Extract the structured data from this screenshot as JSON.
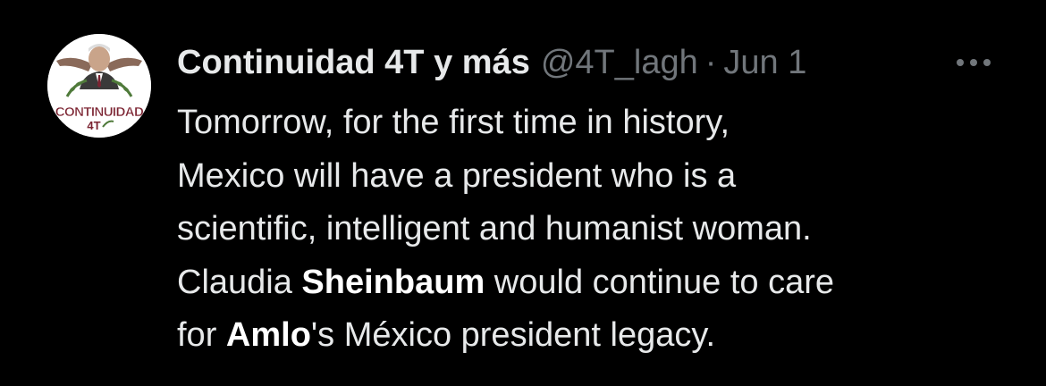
{
  "tweet": {
    "author": {
      "display_name": "Continuidad 4T y más",
      "handle": "@4T_lagh",
      "avatar_icon": "profile-avatar-icon",
      "avatar_text_top": "CONTINUIDAD",
      "avatar_text_bottom": "4T"
    },
    "separator": "·",
    "timestamp": "Jun 1",
    "more_icon": "more-options-icon",
    "body": {
      "line1": "Tomorrow, for the first time in history,",
      "line2": "Mexico will have a president who is a",
      "line3": "scientific, intelligent and humanist woman.",
      "line4_pre": "Claudia ",
      "line4_bold": "Sheinbaum",
      "line4_post": " would continue to care",
      "line5_pre": "for ",
      "line5_bold": "Amlo",
      "line5_post": "'s México president legacy."
    }
  },
  "colors": {
    "background": "#000000",
    "primary_text": "#e7e9ea",
    "secondary_text": "#71767b",
    "avatar_brand": "#7b2331"
  }
}
